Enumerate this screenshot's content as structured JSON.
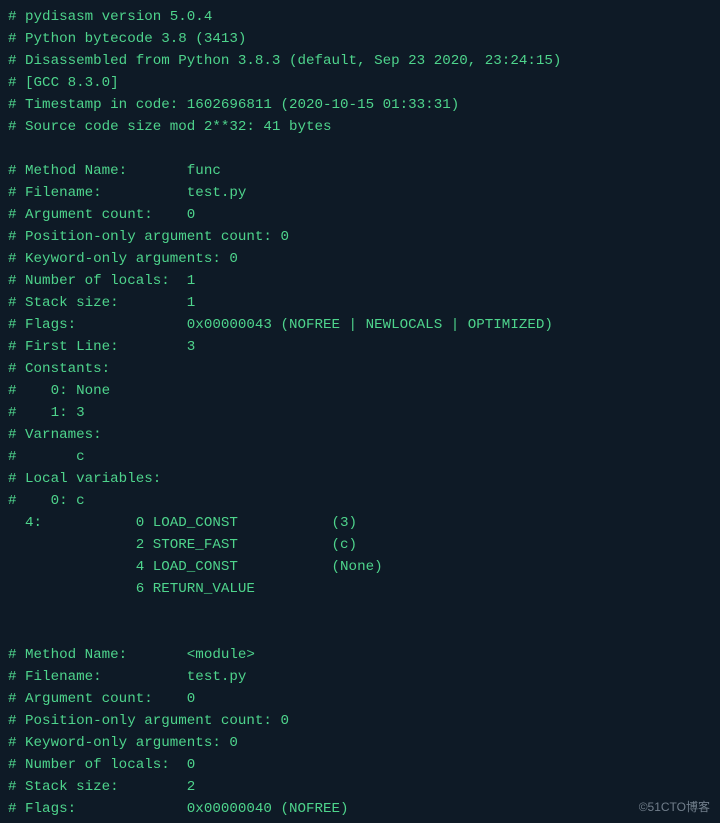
{
  "lines": [
    "# pydisasm version 5.0.4",
    "# Python bytecode 3.8 (3413)",
    "# Disassembled from Python 3.8.3 (default, Sep 23 2020, 23:24:15)",
    "# [GCC 8.3.0]",
    "# Timestamp in code: 1602696811 (2020-10-15 01:33:31)",
    "# Source code size mod 2**32: 41 bytes",
    "",
    "# Method Name:       func",
    "# Filename:          test.py",
    "# Argument count:    0",
    "# Position-only argument count: 0",
    "# Keyword-only arguments: 0",
    "# Number of locals:  1",
    "# Stack size:        1",
    "# Flags:             0x00000043 (NOFREE | NEWLOCALS | OPTIMIZED)",
    "# First Line:        3",
    "# Constants:",
    "#    0: None",
    "#    1: 3",
    "# Varnames:",
    "#\tc",
    "# Local variables:",
    "#    0: c",
    "  4:           0 LOAD_CONST           (3)",
    "               2 STORE_FAST           (c)",
    "               4 LOAD_CONST           (None)",
    "               6 RETURN_VALUE",
    "",
    "",
    "# Method Name:       <module>",
    "# Filename:          test.py",
    "# Argument count:    0",
    "# Position-only argument count: 0",
    "# Keyword-only arguments: 0",
    "# Number of locals:  0",
    "# Stack size:        2",
    "# Flags:             0x00000040 (NOFREE)"
  ],
  "watermark": "©51CTO博客"
}
